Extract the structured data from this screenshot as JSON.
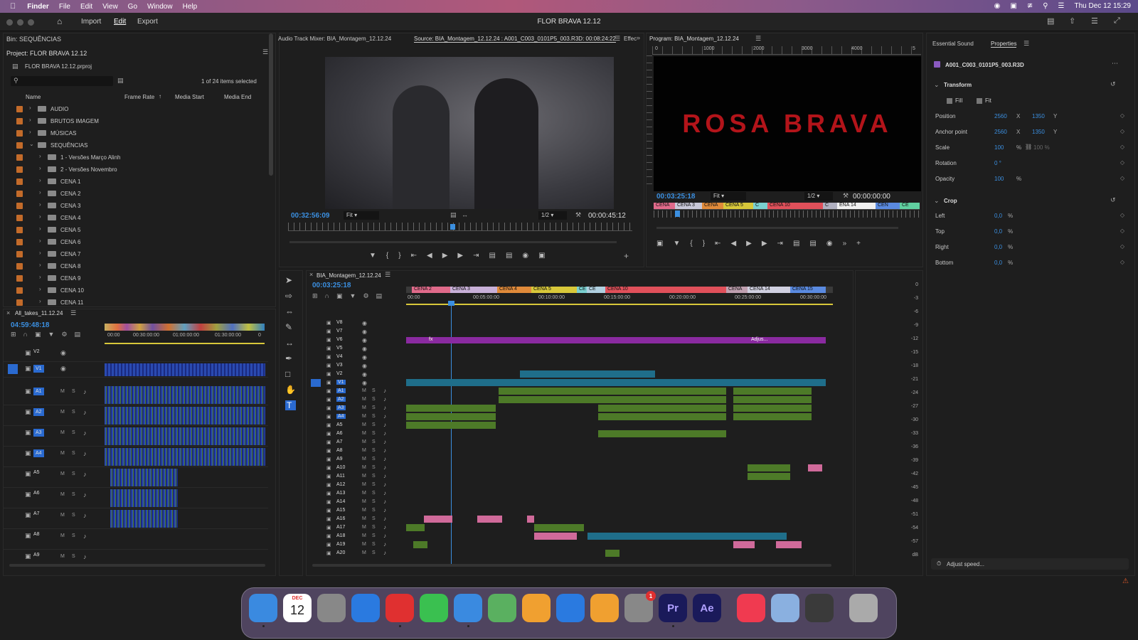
{
  "menubar": {
    "app": "Finder",
    "items": [
      "File",
      "Edit",
      "View",
      "Go",
      "Window",
      "Help"
    ],
    "datetime": "Thu Dec 12  15:29"
  },
  "appbar": {
    "title": "FLOR BRAVA 12.12",
    "nav": [
      "Import",
      "Edit",
      "Export"
    ]
  },
  "project": {
    "bin": "Bin: SEQUÊNCIAS",
    "title": "Project: FLOR BRAVA 12.12",
    "file": "FLOR BRAVA 12.12.prproj",
    "selection": "1 of 24 items selected",
    "cols": [
      "Name",
      "Frame Rate",
      "Media Start",
      "Media End"
    ],
    "items": [
      {
        "name": "AUDIO",
        "indent": 0,
        "open": false
      },
      {
        "name": "BRUTOS IMAGEM",
        "indent": 0,
        "open": false
      },
      {
        "name": "MÚSICAS",
        "indent": 0,
        "open": false
      },
      {
        "name": "SEQUÊNCIAS",
        "indent": 0,
        "open": true
      },
      {
        "name": "1 - Versões  Março Alinh",
        "indent": 1,
        "open": false
      },
      {
        "name": "2 - Versões Novembro",
        "indent": 1,
        "open": false
      },
      {
        "name": "CENA 1",
        "indent": 1,
        "open": false
      },
      {
        "name": "CENA 2",
        "indent": 1,
        "open": false
      },
      {
        "name": "CENA 3",
        "indent": 1,
        "open": false
      },
      {
        "name": "CENA 4",
        "indent": 1,
        "open": false
      },
      {
        "name": "CENA 5",
        "indent": 1,
        "open": false
      },
      {
        "name": "CENA 6",
        "indent": 1,
        "open": false
      },
      {
        "name": "CENA 7",
        "indent": 1,
        "open": false
      },
      {
        "name": "CENA 8",
        "indent": 1,
        "open": false
      },
      {
        "name": "CENA 9",
        "indent": 1,
        "open": false
      },
      {
        "name": "CENA 10",
        "indent": 1,
        "open": false
      },
      {
        "name": "CENA 11",
        "indent": 1,
        "open": false
      }
    ]
  },
  "alltakes": {
    "title": "All_takes_11.12.24",
    "timecode": "04:59:48:18",
    "ruler": [
      "00:00",
      "00:30:00:00",
      "01:00:00:00",
      "01:30:00:00",
      "0"
    ],
    "tracks": [
      "V2",
      "V1",
      "A1",
      "A2",
      "A3",
      "A4",
      "A5",
      "A6",
      "A7",
      "A8",
      "A9"
    ]
  },
  "source": {
    "tabs": [
      "Audio Track Mixer: BIA_Montagem_12.12.24",
      "Source: BIA_Montagem_12.12.24 : A001_C003_0101P5_003.R3D: 00:08:24:22",
      "Effec"
    ],
    "timecode": "00:32:56:09",
    "fit": "Fit",
    "res": "1/2",
    "duration": "00:00:45:12"
  },
  "program": {
    "title": "Program: BIA_Montagem_12.12.24",
    "timecode": "00:03:25:18",
    "fit": "Fit",
    "res": "1/2",
    "duration": "00:00:00:00",
    "frame_text": "ROSA BRAVA",
    "ruler": [
      "0",
      "1000",
      "2000",
      "3000",
      "4000",
      "5"
    ],
    "markers": [
      "CENA",
      "CENA 3",
      "CENA",
      "CENA 5",
      "C",
      "CENA 10",
      "C",
      "ENA 14",
      "CEN",
      "CE"
    ]
  },
  "timeline": {
    "title": "BIA_Montagem_12.12.24",
    "timecode": "00:03:25:18",
    "ruler": [
      "00:00",
      "00:05:00:00",
      "00:10:00:00",
      "00:15:00:00",
      "00:20:00:00",
      "00:25:00:00",
      "00:30:00:00"
    ],
    "markers": [
      "CENA 2",
      "CENA 3",
      "CENA 4",
      "CENA 5",
      "CE",
      "CE",
      "CENA 10",
      "CENA",
      "CENA 14",
      "CENA 15"
    ],
    "vtracks": [
      "V8",
      "V7",
      "V6",
      "V5",
      "V4",
      "V3",
      "V2",
      "V1"
    ],
    "atracks": [
      "A1",
      "A2",
      "A3",
      "A4",
      "A5",
      "A6",
      "A7",
      "A8",
      "A9",
      "A10",
      "A11",
      "A12",
      "A13",
      "A14",
      "A15",
      "A16",
      "A17",
      "A18",
      "A19",
      "A20"
    ],
    "adjust_label": "Adjus...",
    "fx": "fx"
  },
  "meters": [
    "0",
    "-3",
    "-6",
    "-9",
    "-12",
    "-15",
    "-18",
    "-21",
    "-24",
    "-27",
    "-30",
    "-33",
    "-36",
    "-39",
    "-42",
    "-45",
    "-48",
    "-51",
    "-54",
    "-57",
    "dB"
  ],
  "properties": {
    "tabs": [
      "Essential Sound",
      "Properties"
    ],
    "clip": "A001_C003_0101P5_003.R3D",
    "transform": {
      "title": "Transform",
      "fill": "Fill",
      "fit": "Fit",
      "rows": [
        {
          "name": "Position",
          "v1": "2560",
          "u1": "X",
          "v2": "1350",
          "u2": "Y"
        },
        {
          "name": "Anchor point",
          "v1": "2560",
          "u1": "X",
          "v2": "1350",
          "u2": "Y"
        },
        {
          "name": "Scale",
          "v1": "100",
          "u1": "%",
          "v2": "100 %",
          "u2": ""
        },
        {
          "name": "Rotation",
          "v1": "0 °",
          "u1": "",
          "v2": "",
          "u2": ""
        },
        {
          "name": "Opacity",
          "v1": "100",
          "u1": "%",
          "v2": "",
          "u2": ""
        }
      ]
    },
    "crop": {
      "title": "Crop",
      "rows": [
        {
          "name": "Left",
          "v1": "0,0",
          "u1": "%"
        },
        {
          "name": "Top",
          "v1": "0,0",
          "u1": "%"
        },
        {
          "name": "Right",
          "v1": "0,0",
          "u1": "%"
        },
        {
          "name": "Bottom",
          "v1": "0,0",
          "u1": "%"
        }
      ]
    },
    "adjust_speed": "Adjust speed..."
  },
  "dock": {
    "calendar_month": "DEC",
    "calendar_day": "12",
    "settings_badge": "1",
    "apps": [
      "Finder",
      "Calendar",
      "Launchpad",
      "Safari",
      "Opera",
      "Messages",
      "Mail",
      "Maps",
      "Photos",
      "App Store",
      "Pages",
      "System Settings",
      "Premiere Pro",
      "After Effects",
      "Music",
      "Preview",
      "QuickTime",
      "Trash"
    ],
    "pr_label": "Pr",
    "ae_label": "Ae"
  }
}
